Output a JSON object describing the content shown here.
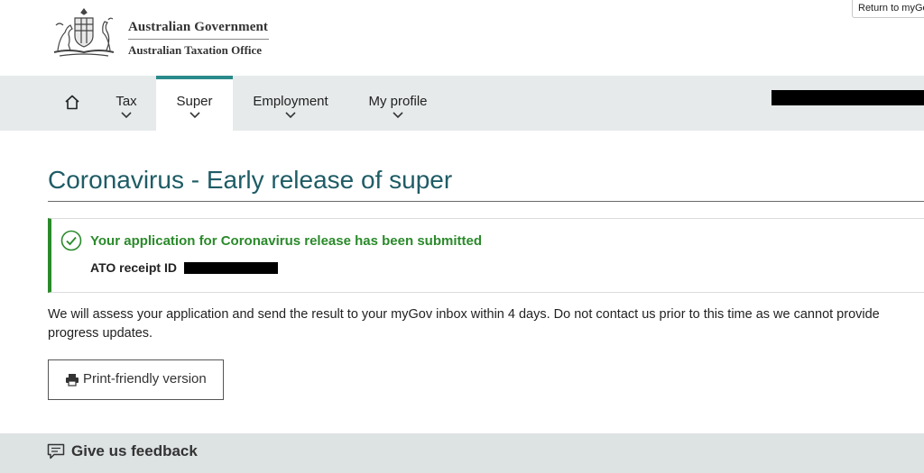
{
  "header": {
    "government": "Australian Government",
    "agency": "Australian Taxation Office",
    "return_link": "Return to myGov"
  },
  "nav": {
    "items": [
      {
        "label": "Tax"
      },
      {
        "label": "Super",
        "active": true
      },
      {
        "label": "Employment"
      },
      {
        "label": "My profile"
      }
    ]
  },
  "main": {
    "title": "Coronavirus - Early release of super",
    "alert": {
      "heading": "Your application for Coronavirus release has been submitted",
      "receipt_label": "ATO receipt ID"
    },
    "body": "We will assess your application and send the result to your myGov inbox within 4 days. Do not contact us prior to this time as we cannot provide progress updates.",
    "print_button": "Print-friendly version"
  },
  "feedback": {
    "label": "Give us feedback"
  },
  "colors": {
    "accent": "#2b8a8a",
    "title": "#1f5c66",
    "success": "#2a8a2a",
    "nav_bg": "#e6eaea"
  },
  "icons": [
    "coat-of-arms-logo",
    "home-icon",
    "chevron-down-icon",
    "check-circle-icon",
    "printer-icon",
    "comment-icon"
  ]
}
